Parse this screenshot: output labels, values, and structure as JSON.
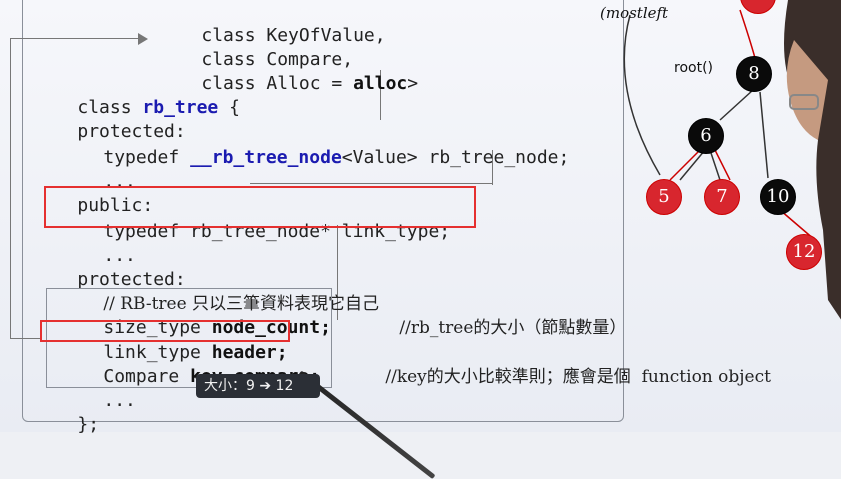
{
  "code": {
    "line1": "class KeyOfValue,",
    "line2": "class Compare,",
    "line3_a": "class Alloc = ",
    "line3_b": "alloc",
    "line3_c": ">",
    "line4_a": "class ",
    "line4_b": "rb_tree",
    "line4_c": " {",
    "line5": "protected:",
    "line6_a": "typedef ",
    "line6_b": "__rb_tree_node",
    "line6_c": "<Value> rb_tree_node;",
    "line7": "...",
    "line8": "public:",
    "line9": "typedef rb_tree_node* link_type;",
    "line10": "...",
    "line11": "protected:",
    "line12": "// RB-tree 只以三筆資料表現它自己",
    "line13_a": "size_type ",
    "line13_b": "node_count;",
    "line13_c": "//rb_tree的大小（節點數量）",
    "line14_a": "link_type ",
    "line14_b": "header;",
    "line15_a": "Compare ",
    "line15_b": "key_compare;",
    "line15_c": "//key的大小比較準則；應會是個  function object",
    "line16": "...",
    "line17": "};"
  },
  "tree": {
    "top_label": "(mostleft",
    "root_label": "root()",
    "nodes": {
      "n8": "8",
      "n6": "6",
      "n5": "5",
      "n7": "7",
      "n10": "10",
      "n12": "12"
    }
  },
  "tooltip": {
    "text": "大小：9 ➔ 12"
  },
  "colors": {
    "highlight_box": "#e53030",
    "red_node": "#d8262e",
    "black_node": "#0a0a0a",
    "keyword": "#2b2ba8"
  }
}
